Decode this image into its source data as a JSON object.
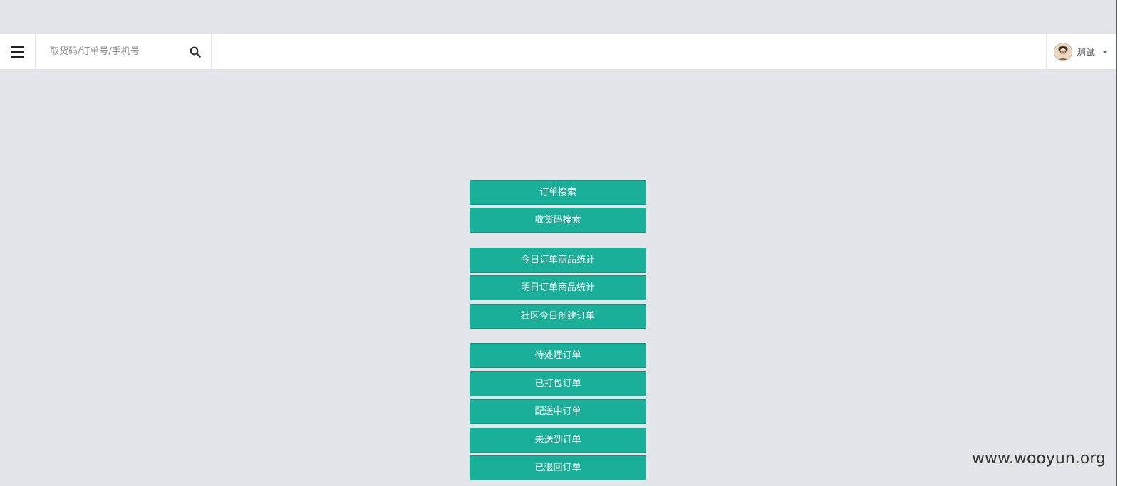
{
  "header": {
    "search": {
      "placeholder": "取货码/订单号/手机号",
      "value": ""
    },
    "user": {
      "name": "测试"
    }
  },
  "buttons": {
    "order_search": "订单搜索",
    "pickup_code_search": "收货码搜索",
    "today_order_stats": "今日订单商品统计",
    "tomorrow_order_stats": "明日订单商品统计",
    "community_today_orders": "社区今日创建订单",
    "pending_orders": "待处理订单",
    "packed_orders": "已打包订单",
    "delivering_orders": "配送中订单",
    "undelivered_orders": "未送到订单",
    "returned_orders": "已退回订单"
  },
  "watermark": "www.wooyun.org",
  "colors": {
    "background": "#e2e6ea",
    "button": "#1aaf98",
    "topbar": "#ffffff"
  },
  "icons": {
    "menu": "hamburger-icon",
    "search": "search-icon",
    "dropdown": "caret-down-icon"
  }
}
